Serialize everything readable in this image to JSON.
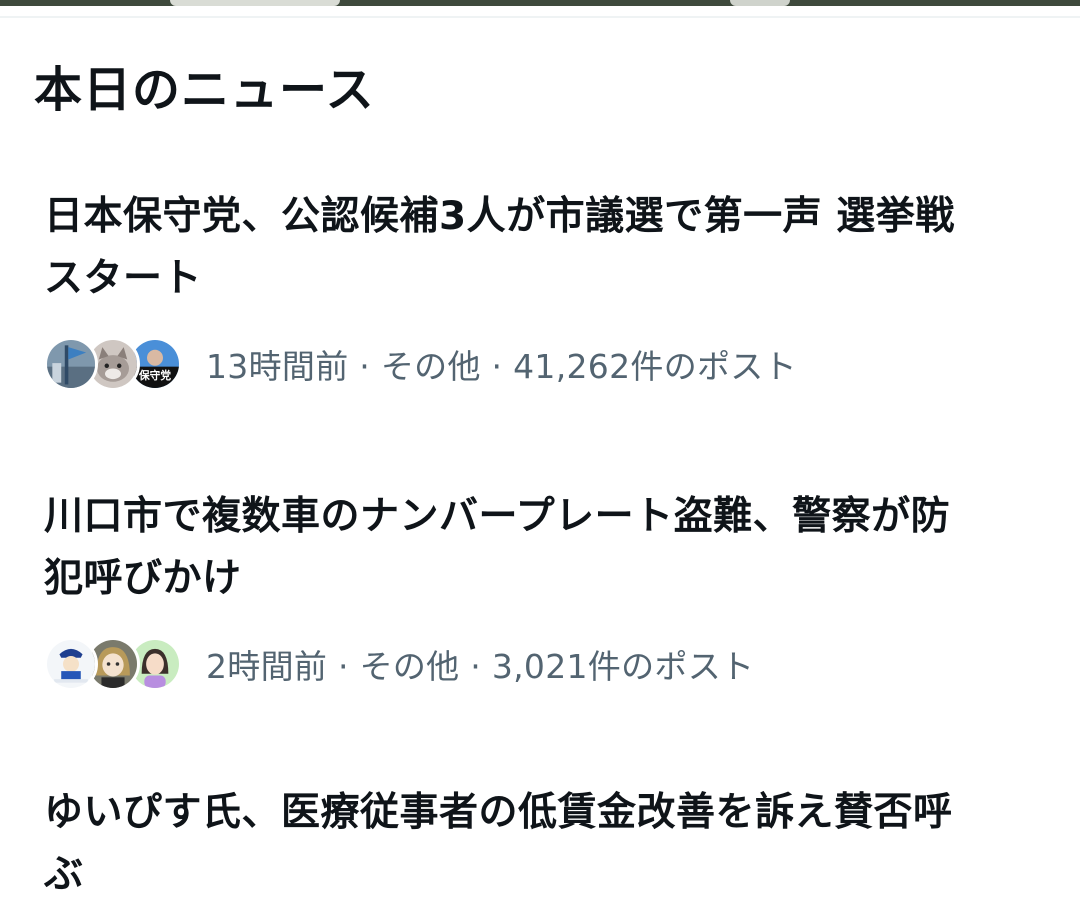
{
  "section": {
    "title": "本日のニュース"
  },
  "news": [
    {
      "headline_line1": "日本保守党、公認候補3人が市議選で第一声 選挙戦",
      "headline_line2": "スタート",
      "meta": "13時間前 · その他 · 41,262件のポスト",
      "avatars": [
        "flag-photo-avatar",
        "cat-avatar",
        "party-logo-avatar"
      ],
      "avatar_logo_text": "保守党"
    },
    {
      "headline_line1": "川口市で複数車のナンバープレート盗難、警察が防",
      "headline_line2": "犯呼びかけ",
      "meta": "2時間前 · その他 · 3,021件のポスト",
      "avatars": [
        "police-mascot-avatar",
        "anime-girl-avatar",
        "illustrated-woman-avatar"
      ]
    },
    {
      "headline_line1": "ゆいぴす氏、医療従事者の低賃金改善を訴え賛否呼",
      "headline_line2": "ぶ"
    }
  ],
  "colors": {
    "text_primary": "#0f1419",
    "text_secondary": "#536471",
    "divider": "#eff3f4"
  }
}
